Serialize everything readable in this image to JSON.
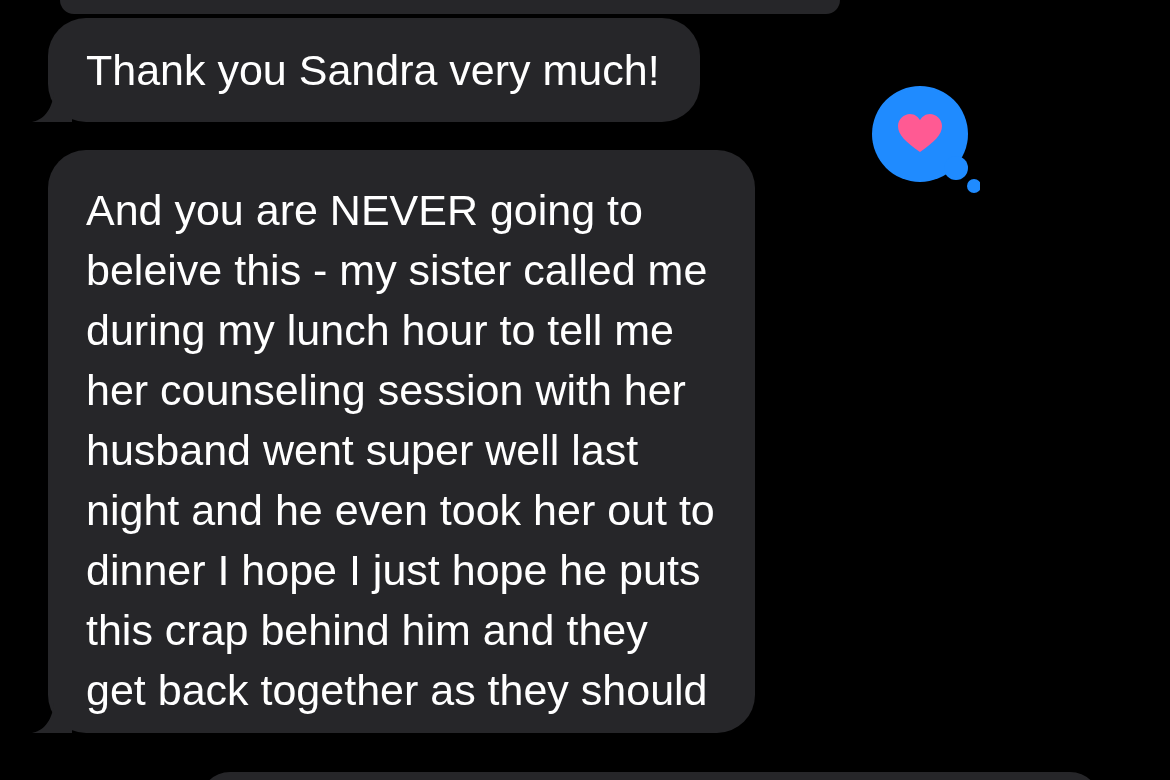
{
  "messages": [
    {
      "kind": "partial-top"
    },
    {
      "kind": "text",
      "lines": [
        "Thank you Sandra very much!"
      ],
      "tail": true
    },
    {
      "kind": "text",
      "lines": [
        "And you are NEVER going to",
        "beleive this - my sister called me",
        "during my lunch hour to tell me",
        "her counseling session with her",
        "husband went super well last",
        "night and he even took her out to",
        "dinner I hope I just hope he puts",
        "this crap behind him and they",
        "get back together as they should"
      ],
      "tail": true,
      "reaction": {
        "kind": "heart"
      }
    },
    {
      "kind": "partial-bottom"
    }
  ]
}
